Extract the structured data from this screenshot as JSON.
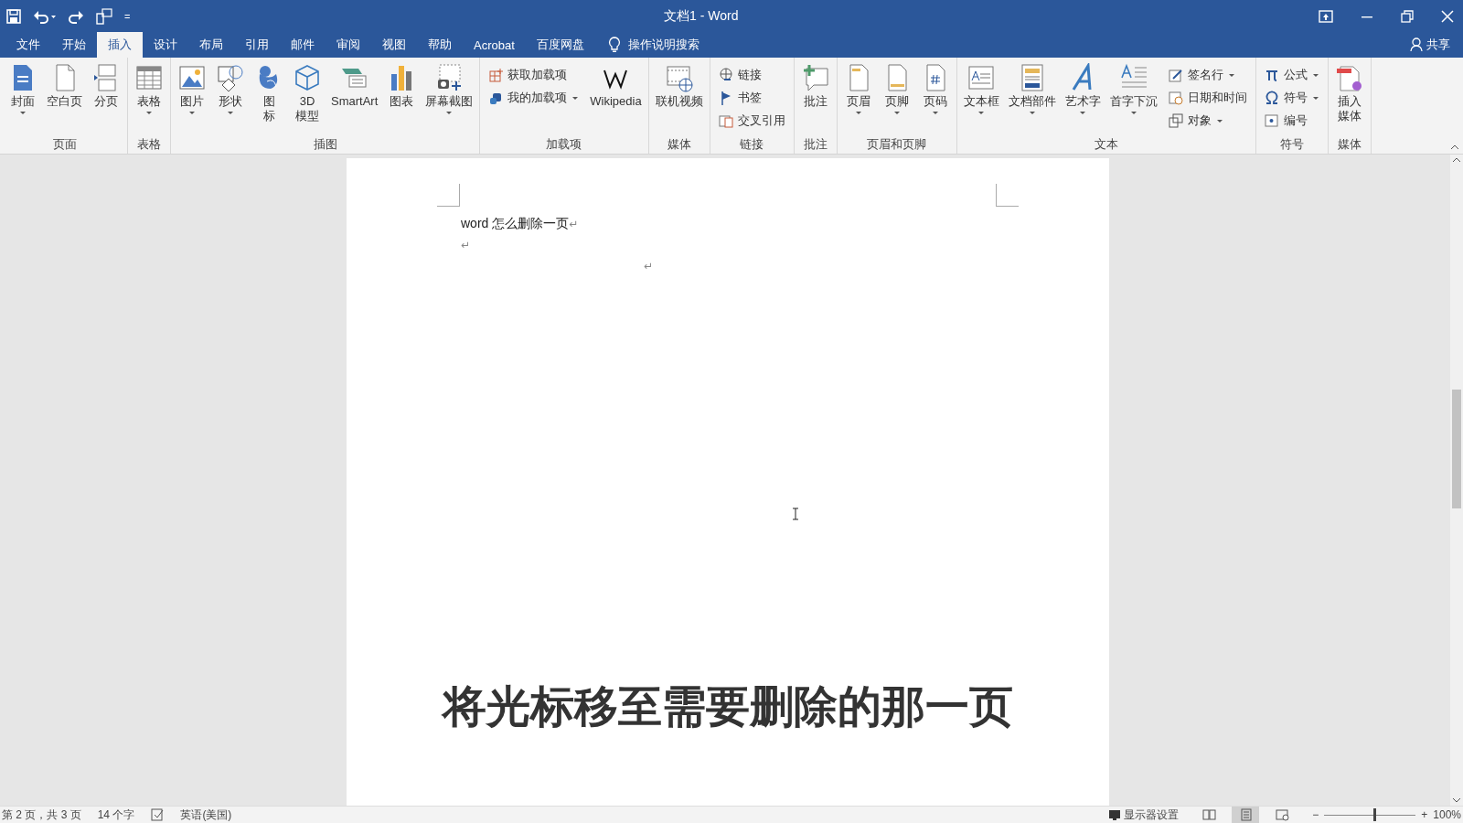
{
  "window": {
    "title": "文档1 - Word"
  },
  "quick_access": {
    "customize": "="
  },
  "tabs": [
    {
      "label": "文件",
      "selected": false
    },
    {
      "label": "开始",
      "selected": false
    },
    {
      "label": "插入",
      "selected": true
    },
    {
      "label": "设计",
      "selected": false
    },
    {
      "label": "布局",
      "selected": false
    },
    {
      "label": "引用",
      "selected": false
    },
    {
      "label": "邮件",
      "selected": false
    },
    {
      "label": "审阅",
      "selected": false
    },
    {
      "label": "视图",
      "selected": false
    },
    {
      "label": "帮助",
      "selected": false
    },
    {
      "label": "Acrobat",
      "selected": false
    },
    {
      "label": "百度网盘",
      "selected": false
    }
  ],
  "tell_me": "操作说明搜索",
  "share": "共享",
  "ribbon": [
    {
      "label": "页面",
      "items": [
        {
          "kind": "large",
          "lines": [
            "封面"
          ],
          "dropdown": true
        },
        {
          "kind": "large",
          "lines": [
            "空白页"
          ],
          "dropdown": false
        },
        {
          "kind": "large",
          "lines": [
            "分页"
          ],
          "dropdown": false
        }
      ]
    },
    {
      "label": "表格",
      "items": [
        {
          "kind": "large",
          "lines": [
            "表格"
          ],
          "dropdown": true
        }
      ]
    },
    {
      "label": "插图",
      "items": [
        {
          "kind": "large",
          "lines": [
            "图片"
          ],
          "dropdown": true
        },
        {
          "kind": "large",
          "lines": [
            "形状"
          ],
          "dropdown": true
        },
        {
          "kind": "large",
          "lines": [
            "图",
            "标"
          ],
          "dropdown": false
        },
        {
          "kind": "large",
          "lines": [
            "3D",
            "模型"
          ],
          "dropdown": false
        },
        {
          "kind": "large",
          "lines": [
            "SmartArt"
          ],
          "dropdown": false
        },
        {
          "kind": "large",
          "lines": [
            "图表"
          ],
          "dropdown": false
        },
        {
          "kind": "large",
          "lines": [
            "屏幕截图"
          ],
          "dropdown": true
        }
      ]
    },
    {
      "label": "加载项",
      "items": [
        {
          "kind": "column",
          "entries": [
            {
              "label": "获取加载项",
              "dropdown": false
            },
            {
              "label": "我的加载项",
              "dropdown": true
            }
          ]
        },
        {
          "kind": "large",
          "lines": [
            "Wikipedia"
          ],
          "dropdown": false
        }
      ]
    },
    {
      "label": "媒体",
      "items": [
        {
          "kind": "large",
          "lines": [
            "联机视频"
          ],
          "dropdown": false
        }
      ]
    },
    {
      "label": "链接",
      "items": [
        {
          "kind": "column",
          "entries": [
            {
              "label": "链接",
              "dropdown": false
            },
            {
              "label": "书签",
              "dropdown": false
            },
            {
              "label": "交叉引用",
              "dropdown": false
            }
          ]
        }
      ]
    },
    {
      "label": "批注",
      "items": [
        {
          "kind": "large",
          "lines": [
            "批注"
          ],
          "dropdown": false
        }
      ]
    },
    {
      "label": "页眉和页脚",
      "items": [
        {
          "kind": "large",
          "lines": [
            "页眉"
          ],
          "dropdown": true
        },
        {
          "kind": "large",
          "lines": [
            "页脚"
          ],
          "dropdown": true
        },
        {
          "kind": "large",
          "lines": [
            "页码"
          ],
          "dropdown": true
        }
      ]
    },
    {
      "label": "文本",
      "items": [
        {
          "kind": "large",
          "lines": [
            "文本框"
          ],
          "dropdown": true
        },
        {
          "kind": "large",
          "lines": [
            "文档部件"
          ],
          "dropdown": true
        },
        {
          "kind": "large",
          "lines": [
            "艺术字"
          ],
          "dropdown": true
        },
        {
          "kind": "large",
          "lines": [
            "首字下沉"
          ],
          "dropdown": true
        },
        {
          "kind": "column",
          "entries": [
            {
              "label": "签名行",
              "dropdown": true
            },
            {
              "label": "日期和时间",
              "dropdown": false
            },
            {
              "label": "对象",
              "dropdown": true
            }
          ]
        }
      ]
    },
    {
      "label": "符号",
      "items": [
        {
          "kind": "column",
          "entries": [
            {
              "label": "公式",
              "dropdown": true
            },
            {
              "label": "符号",
              "dropdown": true
            },
            {
              "label": "编号",
              "dropdown": false
            }
          ]
        }
      ]
    },
    {
      "label": "媒体",
      "items": [
        {
          "kind": "large",
          "lines": [
            "插入",
            "媒体"
          ],
          "dropdown": false
        }
      ]
    }
  ],
  "document": {
    "paragraphs": [
      {
        "text": "word 怎么删除一页",
        "mark": "↵"
      },
      {
        "mark": "↵"
      },
      {
        "mark": "↵"
      }
    ]
  },
  "subtitle": "将光标移至需要删除的那一页",
  "status_bar": {
    "page": "第 2 页，共 3 页",
    "words": "14 个字",
    "language": "英语(美国)",
    "display_settings": "显示器设置",
    "views": [
      {
        "selected": false
      },
      {
        "selected": true
      },
      {
        "selected": false
      }
    ],
    "zoom_out": "−",
    "zoom_in": "+",
    "zoom": {
      "level": 0.55
    },
    "zoom_percent": "100%"
  }
}
